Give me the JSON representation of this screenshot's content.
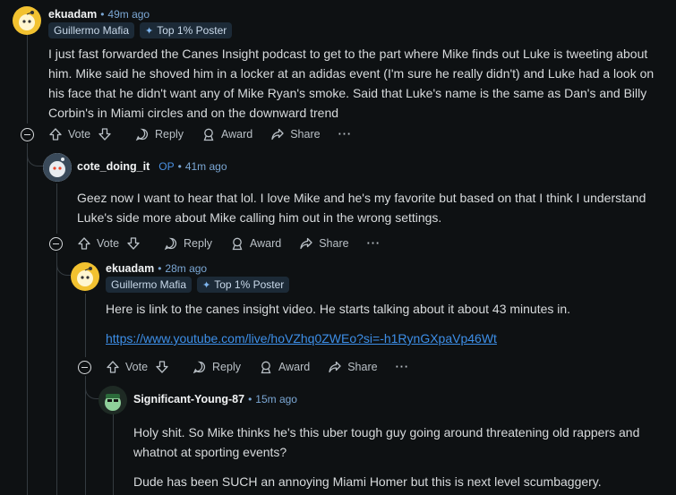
{
  "comments": [
    {
      "username": "ekuadam",
      "time": "49m ago",
      "flairs": [
        "Guillermo Mafia",
        "Top 1% Poster"
      ],
      "body": "I just fast forwarded the Canes Insight podcast to get to the part where Mike finds out Luke is tweeting about him. Mike said he shoved him in a locker at an adidas event (I'm sure he really didn't) and Luke had a look on his face that he didn't want any of Mike Ryan's smoke. Said that Luke's name is the same as Dan's and Billy Corbin's in Miami circles and on the downward trend"
    },
    {
      "username": "cote_doing_it",
      "op": "OP",
      "time": "41m ago",
      "body": "Geez now I want to hear that lol. I love Mike and he's my favorite but based on that I think I understand Luke's side more about Mike calling him out in the wrong settings."
    },
    {
      "username": "ekuadam",
      "time": "28m ago",
      "flairs": [
        "Guillermo Mafia",
        "Top 1% Poster"
      ],
      "body": "Here is link to the canes insight video. He starts talking about it about 43 minutes in.",
      "link": "https://www.youtube.com/live/hoVZhq0ZWEo?si=-h1RynGXpaVp46Wt"
    },
    {
      "username": "Significant-Young-87",
      "time": "15m ago",
      "body": "Holy shit. So Mike thinks he's this uber tough guy going around threatening old rappers and whatnot at sporting events?",
      "body2": "Dude has been SUCH an annoying Miami Homer but this is next level scumbaggery."
    }
  ],
  "actions": {
    "vote": "Vote",
    "reply": "Reply",
    "award": "Award",
    "share": "Share",
    "more": "···"
  },
  "colors": {
    "background": "#0e1113",
    "meta": "#7ba7d4",
    "link": "#3d8fe8",
    "flair_bg": "#1c2a37"
  }
}
